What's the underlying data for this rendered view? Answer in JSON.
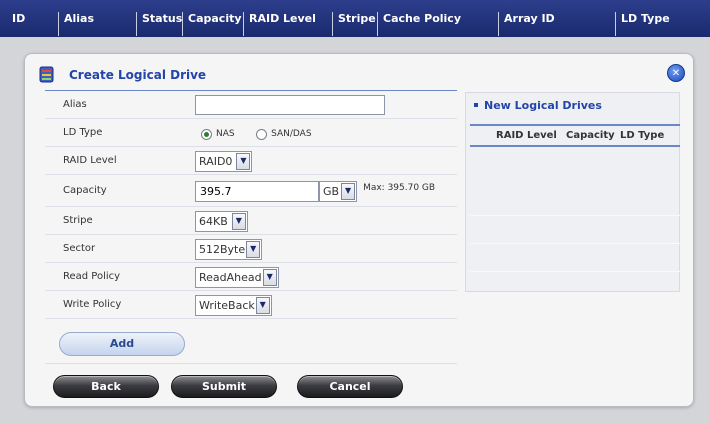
{
  "columns": [
    "ID",
    "Alias",
    "Status",
    "Capacity",
    "RAID Level",
    "Stripe",
    "Cache Policy",
    "Array ID",
    "LD Type"
  ],
  "dialog": {
    "title": "Create Logical Drive",
    "close_icon": "close-icon",
    "fields": {
      "alias": {
        "label": "Alias",
        "value": ""
      },
      "ld_type": {
        "label": "LD Type",
        "options": [
          "NAS",
          "SAN/DAS"
        ],
        "selected": "NAS"
      },
      "raid_level": {
        "label": "RAID Level",
        "value": "RAID0"
      },
      "capacity": {
        "label": "Capacity",
        "value": "395.7",
        "unit": "GB",
        "max": "Max: 395.70 GB"
      },
      "stripe": {
        "label": "Stripe",
        "value": "64KB"
      },
      "sector": {
        "label": "Sector",
        "value": "512Byte"
      },
      "read_policy": {
        "label": "Read Policy",
        "value": "ReadAhead"
      },
      "write_policy": {
        "label": "Write Policy",
        "value": "WriteBack"
      }
    },
    "add_label": "Add",
    "back_label": "Back",
    "submit_label": "Submit",
    "cancel_label": "Cancel",
    "side": {
      "title": "New Logical Drives",
      "headers": [
        "RAID Level",
        "Capacity",
        "LD Type"
      ]
    }
  },
  "colors": {
    "topbar": "#1f2f78",
    "accent": "#2344a8"
  }
}
